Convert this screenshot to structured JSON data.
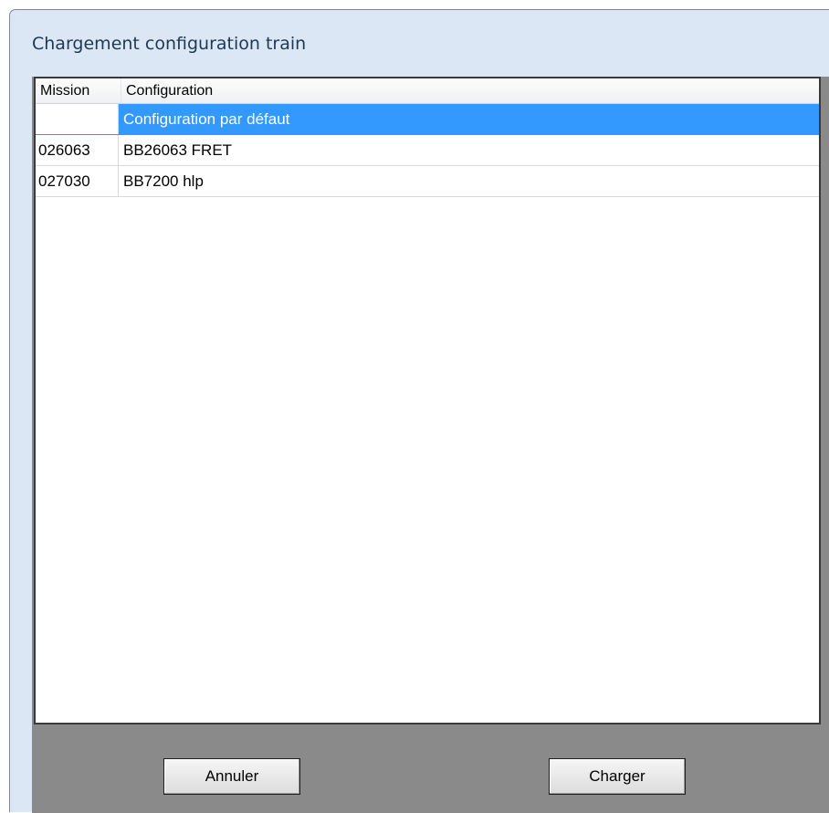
{
  "window": {
    "title": "Chargement configuration train"
  },
  "list": {
    "columns": {
      "mission": "Mission",
      "configuration": "Configuration"
    },
    "rows": [
      {
        "mission": "",
        "configuration": "Configuration par défaut",
        "selected": true
      },
      {
        "mission": "026063",
        "configuration": "BB26063 FRET",
        "selected": false
      },
      {
        "mission": "027030",
        "configuration": "BB7200 hlp",
        "selected": false
      }
    ]
  },
  "buttons": {
    "cancel_label": "Annuler",
    "load_label": "Charger"
  },
  "colors": {
    "selection": "#3399ff",
    "window_frame": "#dbe7f4",
    "client_area": "#8a8a8a"
  }
}
